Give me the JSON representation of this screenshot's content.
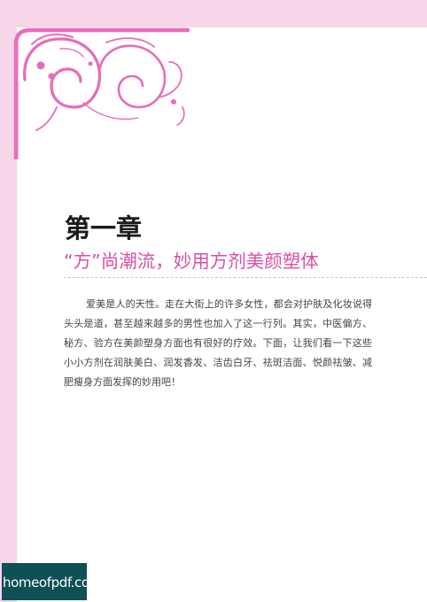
{
  "chapter": {
    "title": "第一章",
    "subtitle": "“方”尚潮流，妙用方剂美颜塑体"
  },
  "body": {
    "paragraph": "爱美是人的天性。走在大街上的许多女性，都会对护肤及化妆说得头头是道，甚至越来越多的男性也加入了这一行列。其实，中医偏方、秘方、验方在美颜塑身方面也有很好的疗效。下面，让我们看一下这些小小方剂在润肤美白、润发香发、洁齿白牙、祛斑洁面、悦颜祛皱、减肥瘦身方面发挥的妙用吧！"
  },
  "watermark": {
    "text": "homeofpdf.com"
  },
  "colors": {
    "frame_pink": "#e86db8",
    "accent_pink": "#d94fa5",
    "background_pink": "#f7d6e9",
    "watermark_bg": "#0f4f56"
  },
  "decoration": {
    "ornament": "pink-swirl-corner-ornament"
  }
}
